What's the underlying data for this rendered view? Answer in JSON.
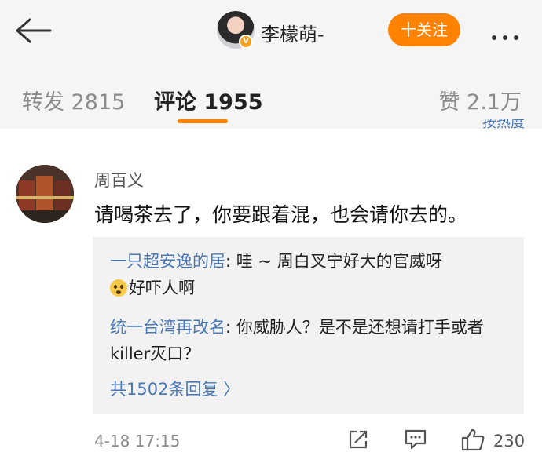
{
  "header": {
    "author_name": "李檬萌-",
    "follow_label": "十关注",
    "verified_badge": "V",
    "icons": {
      "back": "arrow-left-icon",
      "more": "more-dots-icon"
    }
  },
  "tabs": {
    "repost": "转发 2815",
    "comment": "评论 1955",
    "like": "赞 2.1万",
    "sort_hint": "按热度"
  },
  "comment": {
    "user": "周百义",
    "text": "请喝茶去了，你要跟着混，也会请你去的。",
    "replies": [
      {
        "name": "一只超安逸的居",
        "text": ": 哇 ~ 周白叉宁好大的官威呀",
        "text_cont": "好吓人啊",
        "emoji": "scared-face-emoji"
      },
      {
        "name": "统一台湾再改名",
        "text": ": 你威胁人？是不是还想请打手或者killer灭口？"
      }
    ],
    "more_replies": "共1502条回复 〉",
    "time": "4-18 17:15",
    "like_count": "230"
  },
  "colors": {
    "accent": "#ff8200",
    "link": "#4a78b6",
    "header_bg": "#f5f5f5",
    "reply_bg": "#f2f2f2"
  }
}
